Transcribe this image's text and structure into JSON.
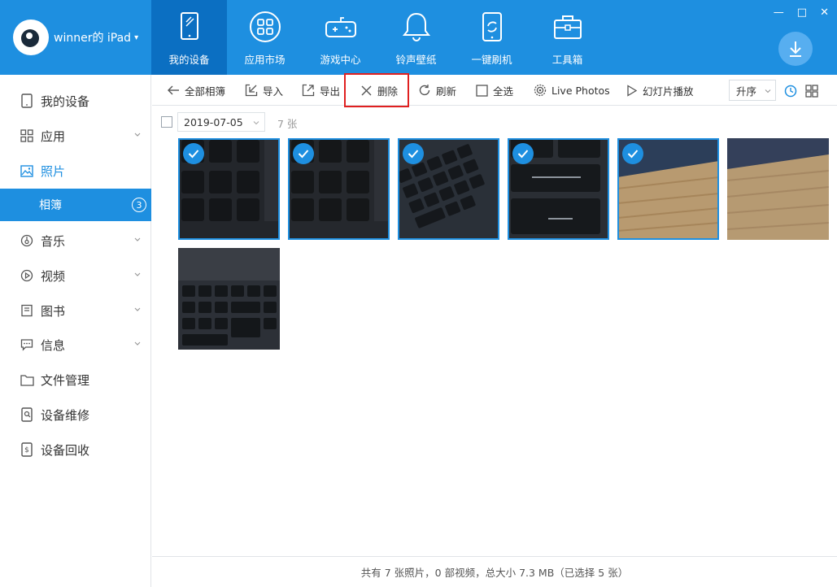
{
  "window": {
    "controls": [
      "—",
      "□",
      "✕"
    ]
  },
  "brand": {
    "name": "winner的 iPad",
    "caret": "▾"
  },
  "nav": [
    {
      "label": "我的设备",
      "icon": "tablet-icon",
      "active": true
    },
    {
      "label": "应用市场",
      "icon": "apps-grid-icon",
      "active": false
    },
    {
      "label": "游戏中心",
      "icon": "gamepad-icon",
      "active": false
    },
    {
      "label": "铃声壁纸",
      "icon": "bell-icon",
      "active": false
    },
    {
      "label": "一键刷机",
      "icon": "phone-refresh-icon",
      "active": false
    },
    {
      "label": "工具箱",
      "icon": "toolbox-icon",
      "active": false
    }
  ],
  "sidebar": {
    "items": [
      {
        "label": "我的设备",
        "icon": "tablet-icon"
      },
      {
        "label": "应用",
        "icon": "apps-grid-icon",
        "expandable": true
      },
      {
        "label": "照片",
        "icon": "image-icon",
        "highlight": true
      },
      {
        "label": "相簿",
        "badge": "3",
        "active": true
      },
      {
        "label": "音乐",
        "icon": "music-icon",
        "expandable": true
      },
      {
        "label": "视频",
        "icon": "play-icon",
        "expandable": true
      },
      {
        "label": "图书",
        "icon": "book-icon",
        "expandable": true
      },
      {
        "label": "信息",
        "icon": "message-icon",
        "expandable": true
      },
      {
        "label": "文件管理",
        "icon": "folder-icon"
      },
      {
        "label": "设备维修",
        "icon": "repair-icon"
      },
      {
        "label": "设备回收",
        "icon": "recycle-coin-icon"
      }
    ]
  },
  "toolbar": {
    "back_label": "全部相簿",
    "import_label": "导入",
    "export_label": "导出",
    "delete_label": "删除",
    "refresh_label": "刷新",
    "select_all_label": "全选",
    "live_photos_label": "Live Photos",
    "slideshow_label": "幻灯片播放",
    "sort_label": "升序"
  },
  "album": {
    "date": "2019-07-05",
    "count": "7 张",
    "photos": [
      {
        "selected": true,
        "subject": "keyboard-keys-1"
      },
      {
        "selected": true,
        "subject": "keyboard-keys-2"
      },
      {
        "selected": true,
        "subject": "keyboard-numpad"
      },
      {
        "selected": true,
        "subject": "keyboard-backspace"
      },
      {
        "selected": true,
        "subject": "wood-desk"
      },
      {
        "selected": false,
        "subject": "wood-desk-2"
      },
      {
        "selected": false,
        "subject": "keyboard-overview"
      }
    ]
  },
  "status": {
    "summary": "共有 7 张照片，0 部视频，总大小 7.3 MB（已选择 5 张）"
  },
  "colors": {
    "primary": "#1e8fe0",
    "nav_active": "#0b6fc2",
    "highlight_frame": "#e02020"
  }
}
